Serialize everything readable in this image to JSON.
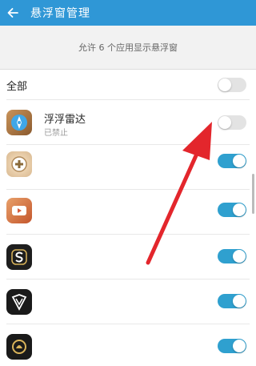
{
  "header": {
    "title": "悬浮窗管理"
  },
  "hint": "允许 6 个应用显示悬浮窗",
  "all": {
    "label": "全部",
    "enabled": false
  },
  "apps": [
    {
      "name": "浮浮雷达",
      "status": "已禁止",
      "enabled": false,
      "icon": "compass-app-icon"
    },
    {
      "name": "",
      "status": "",
      "enabled": true,
      "icon": "game-controller-app-icon"
    },
    {
      "name": "",
      "status": "",
      "enabled": true,
      "icon": "video-app-icon"
    },
    {
      "name": "",
      "status": "",
      "enabled": true,
      "icon": "s-logo-app-icon"
    },
    {
      "name": "",
      "status": "",
      "enabled": true,
      "icon": "shield-app-icon"
    },
    {
      "name": "",
      "status": "",
      "enabled": true,
      "icon": "ring-app-icon"
    }
  ],
  "colors": {
    "accent": "#2f97d6",
    "toggle_on": "#2fa0cf",
    "annotation": "#e3262c"
  }
}
